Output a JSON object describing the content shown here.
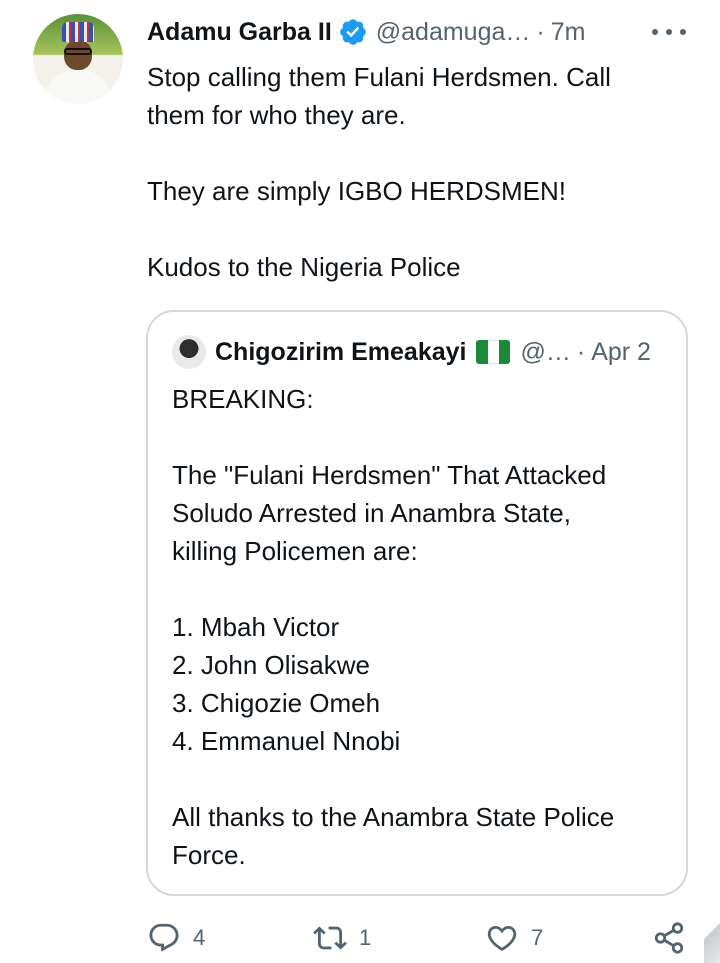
{
  "tweet": {
    "author": {
      "display_name": "Adamu Garba II",
      "handle": "@adamuga…",
      "verified": true,
      "avatar": "avatar-photo"
    },
    "separator": "·",
    "time": "7m",
    "more_icon": "more-horizontal-icon",
    "text_lines": [
      "Stop calling them Fulani Herdsmen. Call",
      "them for who they are.",
      "",
      "They are simply IGBO HERDSMEN!",
      "",
      "Kudos to the Nigeria Police"
    ]
  },
  "quote": {
    "author": {
      "display_name": "Chigozirim Emeakayi",
      "flag": "nigeria-flag-emoji",
      "handle": "@…"
    },
    "separator": "·",
    "time": "Apr 2",
    "text_lines": [
      "BREAKING:",
      "",
      "The \"Fulani Herdsmen\" That Attacked",
      "Soludo Arrested in Anambra State,",
      "killing Policemen are:",
      "",
      "1. Mbah Victor",
      "2. John Olisakwe",
      "3. Chigozie Omeh",
      "4. Emmanuel Nnobi",
      "",
      "All thanks to the Anambra State Police",
      "Force."
    ]
  },
  "actions": {
    "reply": {
      "icon": "reply-icon",
      "count": "4"
    },
    "retweet": {
      "icon": "retweet-icon",
      "count": "1"
    },
    "like": {
      "icon": "heart-icon",
      "count": "7"
    },
    "share": {
      "icon": "share-icon"
    }
  },
  "colors": {
    "text": "#0f1419",
    "secondary": "#536471",
    "verified_blue": "#1d9bf0",
    "border": "#cfd9de",
    "flag_green": "#1a8a3a"
  }
}
